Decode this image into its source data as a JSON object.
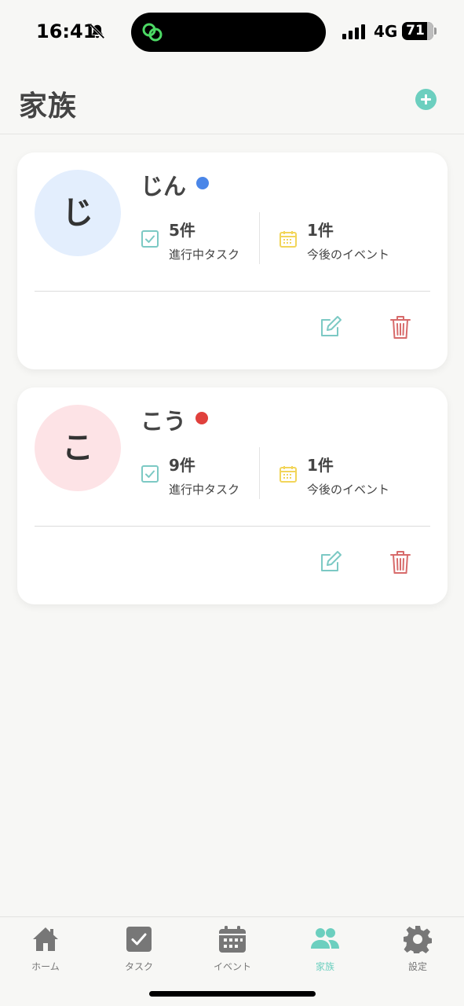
{
  "status_bar": {
    "time": "16:41",
    "network": "4G",
    "battery": "71"
  },
  "header": {
    "title": "家族",
    "add_icon": "plus-circle-icon"
  },
  "members": [
    {
      "initial": "じ",
      "name": "じん",
      "avatar_color": "#e3eefd",
      "dot_color": "#4a86e8",
      "tasks_count": "5件",
      "tasks_label": "進行中タスク",
      "events_count": "1件",
      "events_label": "今後のイベント"
    },
    {
      "initial": "こ",
      "name": "こう",
      "avatar_color": "#fde3e6",
      "dot_color": "#e0403c",
      "tasks_count": "9件",
      "tasks_label": "進行中タスク",
      "events_count": "1件",
      "events_label": "今後のイベント"
    }
  ],
  "tab_bar": {
    "tabs": [
      {
        "label": "ホーム",
        "icon": "home-icon"
      },
      {
        "label": "タスク",
        "icon": "task-check-icon"
      },
      {
        "label": "イベント",
        "icon": "calendar-icon"
      },
      {
        "label": "家族",
        "icon": "people-icon",
        "active": true
      },
      {
        "label": "設定",
        "icon": "gear-icon"
      }
    ]
  },
  "colors": {
    "accent": "#6ccfbf",
    "task_icon": "#7cc9c4",
    "event_icon": "#f2d55a",
    "edit_icon": "#7cc9c4",
    "delete_icon": "#d76b6b",
    "tab_inactive": "#777777"
  }
}
